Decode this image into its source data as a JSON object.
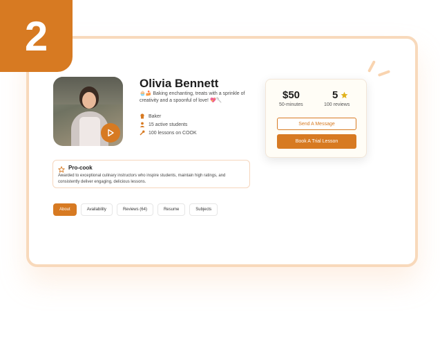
{
  "step": {
    "number": "2"
  },
  "profile": {
    "name": "Olivia Bennett",
    "bio": "🧁🍰 Baking enchanting, treats with a sprinkle of creativity and a spoonful of love! 💖🥄",
    "meta": [
      {
        "icon": "chef-hat-icon",
        "text": "Baker"
      },
      {
        "icon": "user-icon",
        "text": "15 active students"
      },
      {
        "icon": "wrench-icon",
        "text": "100 lessons on COOK"
      }
    ]
  },
  "badge": {
    "title": "Pro-cook",
    "description": "Awarded to exceptional culinary instructors who inspire students, maintain high ratings, and consistently deliver engaging, delicious lessons."
  },
  "tabs": [
    {
      "label": "About",
      "active": true
    },
    {
      "label": "Availability",
      "active": false
    },
    {
      "label": "Reviews (64)",
      "active": false
    },
    {
      "label": "Resume",
      "active": false
    },
    {
      "label": "Subjects",
      "active": false
    }
  ],
  "pricing": {
    "price": "$50",
    "price_sub": "50-minutes",
    "rating": "5",
    "rating_sub": "100 reviews",
    "send_message": "Send A Message",
    "book_trial": "Book A Trial Lesson"
  },
  "colors": {
    "accent": "#d77a22",
    "frame": "#f8d9bb",
    "star": "#e0b21c"
  }
}
